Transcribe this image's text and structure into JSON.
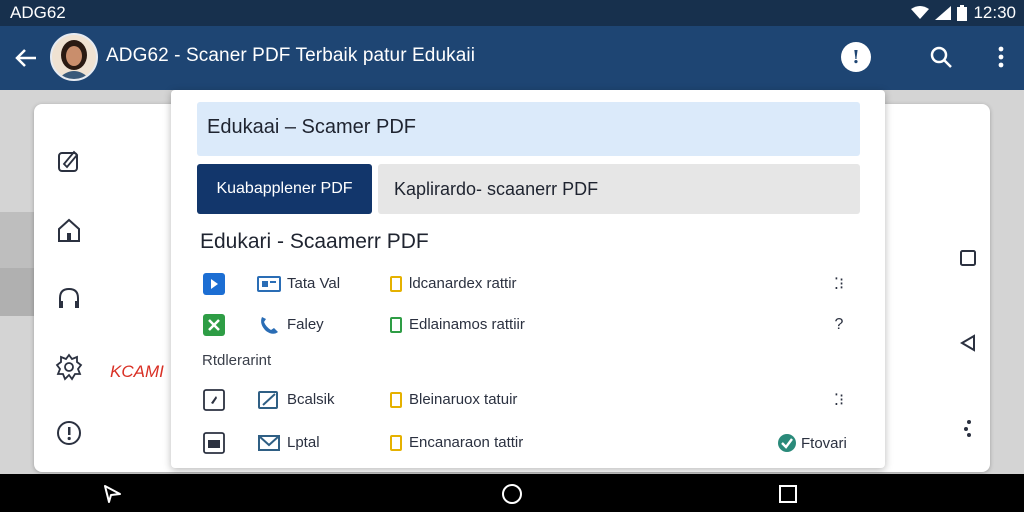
{
  "status_bar": {
    "title": "ADG62",
    "time": "12:30"
  },
  "app_bar": {
    "title": "ADG62 - Scaner PDF Terbaik patur Edukaii",
    "info_label": "!"
  },
  "panel": {
    "field_value": "Edukaai – Scamer PDF",
    "tab_primary": "Kuabapplener PDF",
    "tab_secondary": "Kaplirardo- scaanerr PDF",
    "section_title": "Edukari - Scaamerr PDF",
    "group_label": "Rtdlerarint",
    "rows": [
      {
        "name": "Tata Val",
        "desc": "ldcanardex rattir",
        "trail": "⁚⁝"
      },
      {
        "name": "Faley",
        "desc": "Edlainamos rattiir",
        "trail": "?"
      },
      {
        "name": "Bcalsik",
        "desc": "Bleinaruox tatuir",
        "trail": "⁚⁝"
      },
      {
        "name": "Lptal",
        "desc": "Encanaraon tattir",
        "badge": "Ftovari"
      }
    ]
  },
  "sidebar": {
    "partial_text": "KCAMI"
  },
  "colors": {
    "app_bar": "#1e4573",
    "status_bar": "#17304d",
    "tab_primary": "#12366b",
    "field_bg": "#dbeafa",
    "accent_red": "#d93025"
  }
}
